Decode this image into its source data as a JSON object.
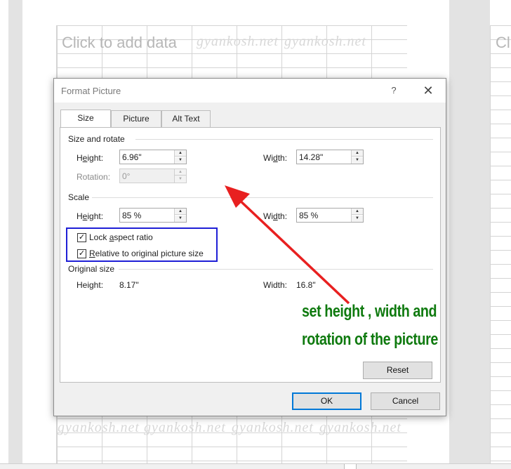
{
  "background": {
    "placeholder_left": "Click to add data",
    "placeholder_right": "Cl",
    "watermark": "gyankosh.net"
  },
  "dialog": {
    "title": "Format Picture",
    "help": "?",
    "close": "✕",
    "tabs": [
      {
        "label": "Size",
        "active": true
      },
      {
        "label": "Picture",
        "active": false
      },
      {
        "label": "Alt Text",
        "active": false
      }
    ],
    "size_and_rotate": {
      "heading": "Size and rotate",
      "height_label_u": "e",
      "height_label_pre": "H",
      "height_label_post": "ight:",
      "height_value": "6.96\"",
      "width_label_pre": "Wi",
      "width_label_u": "d",
      "width_label_post": "th:",
      "width_value": "14.28\"",
      "rotation_label": "Rotation:",
      "rotation_value": "0°"
    },
    "scale": {
      "heading": "Scale",
      "height_label_pre": "H",
      "height_label_u": "e",
      "height_label_post": "ight:",
      "height_value": "85 %",
      "width_label_pre": "Wi",
      "width_label_u": "d",
      "width_label_post": "th:",
      "width_value": "85 %",
      "lock_aspect_pre": "Lock ",
      "lock_aspect_u": "a",
      "lock_aspect_post": "spect ratio",
      "lock_aspect_checked": true,
      "relative_pre": "",
      "relative_u": "R",
      "relative_post": "elative to original picture size",
      "relative_checked": true
    },
    "original_size": {
      "heading": "Original size",
      "height_label": "Height:",
      "height_value": "8.17\"",
      "width_label": "Width:",
      "width_value": "16.8\""
    },
    "reset_label": "Reset",
    "ok_label": "OK",
    "cancel_label": "Cancel"
  },
  "annotation": {
    "line1": "set height , width and",
    "line2": "rotation of the picture",
    "color": "#0f7a0f",
    "arrow_color": "#e82020",
    "highlight_color": "#1f1fd6"
  }
}
